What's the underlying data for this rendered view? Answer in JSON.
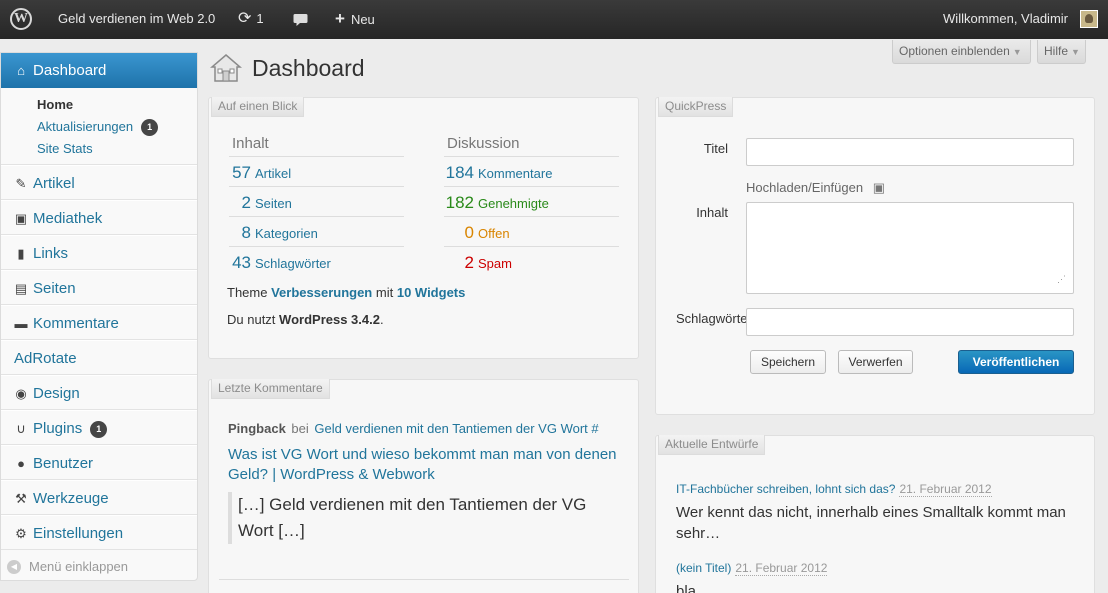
{
  "adminbar": {
    "site_name": "Geld verdienen im Web 2.0",
    "updates_count": "1",
    "new_label": "Neu",
    "welcome": "Willkommen, Vladimir"
  },
  "sidebar": {
    "dashboard": "Dashboard",
    "sub": [
      {
        "label": "Home"
      },
      {
        "label": "Aktualisierungen",
        "badge": "1"
      },
      {
        "label": "Site Stats"
      }
    ],
    "items": [
      {
        "label": "Artikel",
        "icon": "pencil-icon"
      },
      {
        "label": "Mediathek",
        "icon": "media-icon"
      },
      {
        "label": "Links",
        "icon": "links-icon"
      },
      {
        "label": "Seiten",
        "icon": "page-icon"
      },
      {
        "label": "Kommentare",
        "icon": "comment-icon"
      },
      {
        "label": "AdRotate",
        "icon": ""
      },
      {
        "label": "Design",
        "icon": "eye-icon"
      },
      {
        "label": "Plugins",
        "icon": "plugin-icon",
        "badge": "1"
      },
      {
        "label": "Benutzer",
        "icon": "user-icon"
      },
      {
        "label": "Werkzeuge",
        "icon": "wrench-icon"
      },
      {
        "label": "Einstellungen",
        "icon": "gear-icon"
      }
    ],
    "collapse": "Menü einklappen"
  },
  "screen_options": "Optionen einblenden",
  "help": "Hilfe",
  "page_title": "Dashboard",
  "glance": {
    "title": "Auf einen Blick",
    "content_head": "Inhalt",
    "discussion_head": "Diskussion",
    "content": [
      {
        "num": "57",
        "label": "Artikel"
      },
      {
        "num": "2",
        "label": "Seiten"
      },
      {
        "num": "8",
        "label": "Kategorien"
      },
      {
        "num": "43",
        "label": "Schlagwörter"
      }
    ],
    "discussion": [
      {
        "num": "184",
        "label": "Kommentare"
      },
      {
        "num": "182",
        "label": "Genehmigte"
      },
      {
        "num": "0",
        "label": "Offen"
      },
      {
        "num": "2",
        "label": "Spam"
      }
    ],
    "theme_prefix": "Theme",
    "theme_name": "Verbesserungen",
    "theme_mid": "mit",
    "widgets": "10 Widgets",
    "version_prefix": "Du nutzt",
    "version": "WordPress 3.4.2",
    "version_suffix": "."
  },
  "comments": {
    "title": "Letzte Kommentare",
    "type": "Pingback",
    "bei": "bei",
    "post": "Geld verdienen mit den Tantiemen der VG Wort #",
    "link": "Was ist VG Wort und wieso bekommt man man von denen Geld? | WordPress & Webwork",
    "excerpt": "[…] Geld verdienen mit den Tantiemen der VG Wort […]"
  },
  "quickpress": {
    "title": "QuickPress",
    "title_label": "Titel",
    "upload_label": "Hochladen/Einfügen",
    "content_label": "Inhalt",
    "tags_label": "Schlagwörter",
    "save": "Speichern",
    "discard": "Verwerfen",
    "publish": "Veröffentlichen"
  },
  "drafts": {
    "title": "Aktuelle Entwürfe",
    "items": [
      {
        "title": "IT-Fachbücher schreiben, lohnt sich das?",
        "date": "21. Februar 2012",
        "excerpt": "Wer kennt das nicht, innerhalb eines Smalltalk kommt man sehr…"
      },
      {
        "title": "(kein Titel)",
        "date": "21. Februar 2012",
        "excerpt": "bla"
      }
    ]
  }
}
